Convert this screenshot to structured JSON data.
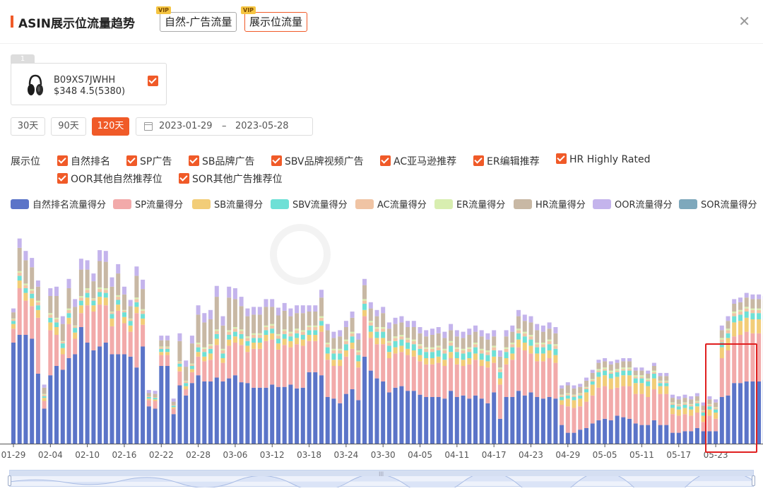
{
  "header": {
    "title": "ASIN展示位流量趋势",
    "tabs": [
      {
        "label": "自然-广告流量",
        "vip": "VIP",
        "active": false
      },
      {
        "label": "展示位流量",
        "vip": "VIP",
        "active": true
      }
    ],
    "close_icon": "close-icon"
  },
  "product": {
    "index": "1",
    "asin": "B09XS7JWHH",
    "price_rating": "$348 4.5(5380)",
    "checked": true
  },
  "range_buttons": [
    {
      "label": "30天",
      "active": false
    },
    {
      "label": "90天",
      "active": false
    },
    {
      "label": "120天",
      "active": true
    }
  ],
  "date_range": {
    "start": "2023-01-29",
    "separator": "–",
    "end": "2023-05-28"
  },
  "filters": {
    "label": "展示位",
    "items": [
      {
        "label": "自然排名",
        "checked": true
      },
      {
        "label": "SP广告",
        "checked": true
      },
      {
        "label": "SB品牌广告",
        "checked": true
      },
      {
        "label": "SBV品牌视频广告",
        "checked": true
      },
      {
        "label": "AC亚马逊推荐",
        "checked": true
      },
      {
        "label": "ER编辑推荐",
        "checked": true
      },
      {
        "label": "HR Highly Rated",
        "checked": true
      },
      {
        "label": "OOR其他自然推荐位",
        "checked": true
      },
      {
        "label": "SOR其他广告推荐位",
        "checked": true
      }
    ]
  },
  "legend": [
    {
      "label": "自然排名流量得分",
      "color": "#5b74c8"
    },
    {
      "label": "SP流量得分",
      "color": "#f2aaaa"
    },
    {
      "label": "SB流量得分",
      "color": "#f2cd78"
    },
    {
      "label": "SBV流量得分",
      "color": "#6ee0d6"
    },
    {
      "label": "AC流量得分",
      "color": "#f0c4a4"
    },
    {
      "label": "ER流量得分",
      "color": "#d8eeb0"
    },
    {
      "label": "HR流量得分",
      "color": "#c8b8a4"
    },
    {
      "label": "OOR流量得分",
      "color": "#c4b4ec"
    },
    {
      "label": "SOR流量得分",
      "color": "#7ea8bc"
    }
  ],
  "chart_data": {
    "type": "bar",
    "stacked": true,
    "x_tick_labels": [
      "01-29",
      "02-04",
      "02-10",
      "02-16",
      "02-22",
      "02-28",
      "03-06",
      "03-12",
      "03-18",
      "03-24",
      "03-30",
      "04-05",
      "04-11",
      "04-17",
      "04-23",
      "04-29",
      "05-05",
      "05-11",
      "05-17",
      "05-23"
    ],
    "date_start": "2023-01-29",
    "total_days": 120,
    "series": [
      {
        "name": "自然排名流量得分",
        "values": [
          130,
          140,
          140,
          135,
          90,
          45,
          88,
          100,
          95,
          110,
          115,
          150,
          130,
          120,
          125,
          130,
          115,
          115,
          115,
          112,
          98,
          125,
          48,
          45,
          100,
          100,
          38,
          75,
          62,
          78,
          88,
          80,
          80,
          85,
          80,
          84,
          88,
          79,
          78,
          72,
          72,
          72,
          76,
          73,
          73,
          76,
          71,
          72,
          92,
          92,
          88,
          60,
          58,
          52,
          64,
          70,
          56,
          112,
          94,
          84,
          80,
          66,
          72,
          74,
          68,
          68,
          63,
          60,
          60,
          60,
          58,
          68,
          60,
          62,
          58,
          62,
          58,
          52,
          66,
          32,
          60,
          60,
          68,
          62,
          66,
          60,
          58,
          60,
          58,
          24,
          14,
          14,
          18,
          20,
          26,
          30,
          32,
          30,
          36,
          34,
          32,
          26,
          24,
          24,
          30,
          24,
          24,
          14,
          14,
          16,
          16,
          20,
          16,
          16,
          16,
          60,
          62,
          78,
          78,
          80,
          80,
          80,
          82,
          82
        ]
      },
      {
        "name": "SP流量得分",
        "values": [
          18,
          60,
          44,
          42,
          72,
          10,
          58,
          40,
          20,
          44,
          20,
          18,
          48,
          50,
          54,
          48,
          36,
          56,
          40,
          32,
          70,
          28,
          8,
          10,
          14,
          14,
          7,
          18,
          8,
          14,
          24,
          26,
          28,
          42,
          24,
          42,
          42,
          48,
          40,
          50,
          50,
          60,
          58,
          48,
          54,
          48,
          57,
          54,
          40,
          40,
          56,
          48,
          42,
          48,
          48,
          52,
          42,
          52,
          42,
          44,
          48,
          44,
          44,
          44,
          46,
          44,
          43,
          42,
          42,
          44,
          42,
          42,
          42,
          38,
          44,
          46,
          42,
          46,
          38,
          44,
          42,
          48,
          56,
          58,
          50,
          46,
          48,
          50,
          46,
          26,
          34,
          32,
          30,
          34,
          36,
          42,
          42,
          40,
          36,
          40,
          42,
          38,
          40,
          36,
          40,
          40,
          40,
          24,
          22,
          22,
          20,
          20,
          12,
          20,
          16,
          50,
          58,
          60,
          62,
          64,
          62,
          62,
          58,
          60
        ]
      },
      {
        "name": "SB流量得分",
        "values": [
          6,
          10,
          10,
          10,
          10,
          4,
          10,
          10,
          8,
          8,
          8,
          10,
          10,
          8,
          10,
          10,
          10,
          8,
          8,
          8,
          8,
          8,
          2,
          2,
          4,
          4,
          2,
          6,
          4,
          4,
          6,
          6,
          8,
          8,
          6,
          8,
          8,
          8,
          8,
          8,
          8,
          8,
          8,
          8,
          8,
          8,
          8,
          8,
          8,
          8,
          8,
          8,
          8,
          8,
          8,
          8,
          8,
          8,
          8,
          8,
          8,
          8,
          8,
          8,
          8,
          8,
          8,
          8,
          8,
          8,
          8,
          8,
          8,
          8,
          8,
          8,
          8,
          8,
          8,
          8,
          8,
          8,
          10,
          10,
          10,
          10,
          10,
          10,
          10,
          6,
          10,
          10,
          10,
          12,
          14,
          14,
          14,
          14,
          14,
          14,
          14,
          14,
          14,
          14,
          14,
          10,
          10,
          8,
          8,
          8,
          8,
          8,
          8,
          8,
          8,
          14,
          16,
          18,
          18,
          18,
          18,
          18,
          18,
          18
        ]
      },
      {
        "name": "SBV流量得分",
        "values": [
          4,
          6,
          6,
          6,
          6,
          2,
          6,
          6,
          6,
          6,
          6,
          6,
          6,
          6,
          6,
          6,
          6,
          6,
          6,
          6,
          6,
          6,
          2,
          2,
          4,
          4,
          2,
          4,
          4,
          4,
          6,
          6,
          6,
          6,
          6,
          6,
          6,
          6,
          6,
          6,
          6,
          6,
          6,
          6,
          6,
          6,
          6,
          6,
          6,
          6,
          6,
          8,
          8,
          8,
          8,
          8,
          8,
          8,
          8,
          8,
          8,
          8,
          8,
          8,
          8,
          8,
          8,
          8,
          8,
          8,
          8,
          8,
          8,
          8,
          8,
          8,
          8,
          8,
          8,
          8,
          8,
          8,
          8,
          8,
          8,
          8,
          8,
          8,
          8,
          4,
          4,
          4,
          4,
          4,
          4,
          6,
          6,
          6,
          6,
          6,
          6,
          6,
          6,
          6,
          6,
          4,
          4,
          4,
          4,
          4,
          4,
          4,
          4,
          4,
          4,
          6,
          6,
          8,
          8,
          8,
          8,
          8,
          8,
          8
        ]
      },
      {
        "name": "AC流量得分",
        "values": [
          2,
          4,
          4,
          4,
          4,
          2,
          4,
          4,
          2,
          4,
          2,
          4,
          4,
          2,
          4,
          4,
          2,
          4,
          2,
          2,
          4,
          4,
          1,
          1,
          2,
          2,
          1,
          2,
          2,
          2,
          4,
          4,
          4,
          4,
          4,
          4,
          4,
          4,
          4,
          4,
          4,
          4,
          4,
          4,
          4,
          4,
          4,
          4,
          4,
          4,
          4,
          4,
          4,
          4,
          4,
          4,
          4,
          4,
          4,
          4,
          4,
          4,
          4,
          4,
          4,
          4,
          4,
          4,
          4,
          4,
          4,
          4,
          4,
          4,
          4,
          4,
          4,
          4,
          4,
          4,
          4,
          4,
          4,
          4,
          4,
          4,
          4,
          4,
          4,
          2,
          2,
          2,
          2,
          2,
          2,
          2,
          2,
          2,
          2,
          2,
          2,
          2,
          2,
          2,
          2,
          2,
          2,
          2,
          2,
          2,
          2,
          2,
          2,
          2,
          2,
          4,
          4,
          4,
          4,
          4,
          4,
          4,
          4,
          4
        ]
      },
      {
        "name": "ER流量得分",
        "values": [
          1,
          2,
          2,
          2,
          2,
          1,
          2,
          2,
          1,
          2,
          1,
          2,
          2,
          1,
          2,
          2,
          1,
          2,
          1,
          1,
          2,
          2,
          0,
          0,
          1,
          1,
          0,
          1,
          1,
          1,
          2,
          2,
          2,
          2,
          2,
          2,
          2,
          2,
          2,
          2,
          2,
          2,
          2,
          2,
          2,
          2,
          2,
          2,
          2,
          2,
          2,
          2,
          2,
          2,
          2,
          2,
          2,
          2,
          2,
          2,
          2,
          2,
          2,
          2,
          2,
          2,
          2,
          2,
          2,
          2,
          2,
          2,
          2,
          2,
          2,
          2,
          2,
          2,
          2,
          2,
          2,
          2,
          2,
          2,
          2,
          2,
          2,
          2,
          2,
          1,
          1,
          1,
          1,
          1,
          1,
          2,
          2,
          2,
          2,
          2,
          2,
          2,
          2,
          2,
          2,
          1,
          1,
          1,
          1,
          1,
          1,
          1,
          1,
          1,
          1,
          2,
          2,
          2,
          2,
          2,
          2,
          2,
          2,
          2
        ]
      },
      {
        "name": "HR流量得分",
        "values": [
          8,
          30,
          30,
          28,
          18,
          8,
          22,
          28,
          22,
          26,
          24,
          34,
          24,
          22,
          34,
          34,
          32,
          28,
          20,
          16,
          28,
          26,
          4,
          4,
          8,
          8,
          4,
          26,
          18,
          26,
          36,
          32,
          32,
          42,
          30,
          42,
          36,
          30,
          26,
          24,
          24,
          24,
          22,
          24,
          24,
          20,
          20,
          22,
          18,
          18,
          24,
          16,
          14,
          16,
          16,
          18,
          14,
          18,
          16,
          14,
          18,
          16,
          16,
          16,
          14,
          16,
          14,
          14,
          16,
          16,
          14,
          14,
          14,
          14,
          16,
          14,
          16,
          14,
          12,
          14,
          14,
          14,
          16,
          14,
          16,
          16,
          14,
          14,
          14,
          8,
          10,
          8,
          8,
          8,
          8,
          8,
          8,
          8,
          8,
          8,
          8,
          6,
          6,
          6,
          6,
          6,
          6,
          6,
          6,
          6,
          6,
          6,
          6,
          6,
          6,
          10,
          10,
          10,
          10,
          12,
          12,
          12,
          12,
          12
        ]
      },
      {
        "name": "OOR流量得分",
        "values": [
          5,
          12,
          12,
          12,
          8,
          4,
          10,
          12,
          10,
          12,
          10,
          14,
          12,
          10,
          14,
          14,
          12,
          12,
          10,
          8,
          12,
          12,
          4,
          4,
          6,
          6,
          4,
          10,
          8,
          10,
          12,
          12,
          12,
          14,
          12,
          14,
          14,
          12,
          10,
          10,
          10,
          10,
          10,
          10,
          10,
          10,
          10,
          10,
          8,
          8,
          10,
          8,
          8,
          8,
          8,
          8,
          8,
          8,
          8,
          8,
          8,
          8,
          8,
          8,
          8,
          8,
          8,
          8,
          8,
          8,
          8,
          8,
          8,
          8,
          8,
          8,
          8,
          8,
          8,
          8,
          8,
          8,
          8,
          8,
          8,
          8,
          8,
          8,
          8,
          4,
          4,
          4,
          4,
          4,
          4,
          4,
          4,
          4,
          4,
          4,
          4,
          4,
          4,
          4,
          4,
          4,
          4,
          4,
          4,
          4,
          4,
          4,
          4,
          4,
          4,
          6,
          6,
          6,
          6,
          6,
          6,
          6,
          6,
          6
        ]
      },
      {
        "name": "SOR流量得分",
        "values": [
          0,
          0,
          0,
          0,
          0,
          0,
          0,
          0,
          0,
          0,
          0,
          0,
          0,
          0,
          0,
          0,
          0,
          0,
          0,
          0,
          0,
          0,
          0,
          0,
          0,
          0,
          0,
          0,
          0,
          0,
          0,
          0,
          0,
          0,
          0,
          0,
          0,
          0,
          0,
          0,
          0,
          0,
          0,
          0,
          0,
          0,
          0,
          0,
          0,
          0,
          0,
          0,
          0,
          0,
          0,
          0,
          0,
          0,
          0,
          0,
          0,
          0,
          0,
          0,
          0,
          0,
          0,
          0,
          0,
          0,
          0,
          0,
          0,
          0,
          0,
          0,
          0,
          0,
          0,
          0,
          0,
          0,
          0,
          0,
          0,
          0,
          0,
          0,
          0,
          0,
          0,
          0,
          0,
          0,
          0,
          0,
          0,
          0,
          0,
          0,
          0,
          0,
          0,
          0,
          0,
          0,
          0,
          0,
          0,
          0,
          0,
          0,
          0,
          0,
          0,
          0,
          0,
          0,
          0,
          0,
          0,
          0,
          0,
          0
        ]
      }
    ]
  }
}
